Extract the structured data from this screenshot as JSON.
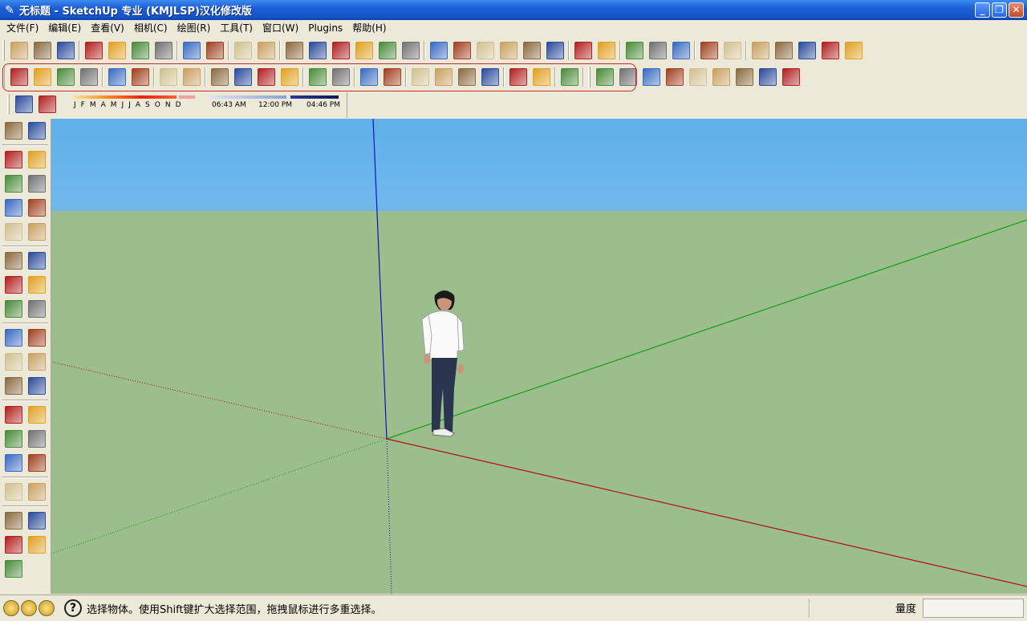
{
  "window": {
    "title": "无标题 - SketchUp 专业 (KMJLSP)汉化修改版",
    "minimize": "_",
    "maximize": "❐",
    "close": "✕"
  },
  "menu": [
    "文件(F)",
    "编辑(E)",
    "查看(V)",
    "相机(C)",
    "绘图(R)",
    "工具(T)",
    "窗口(W)",
    "Plugins",
    "帮助(H)"
  ],
  "shadow": {
    "months": [
      "J",
      "F",
      "M",
      "A",
      "M",
      "J",
      "J",
      "A",
      "S",
      "O",
      "N",
      "D"
    ],
    "time_start": "06:43 AM",
    "time_mid": "12:00 PM",
    "time_end": "04:46 PM"
  },
  "status": {
    "message": "选择物体。使用Shift键扩大选择范围，拖拽鼠标进行多重选择。",
    "measure_label": "量度",
    "measure_value": ""
  },
  "colors": {
    "axis_red": "#b01010",
    "axis_green": "#10a010",
    "axis_blue": "#1010c0",
    "ground": "#9cbd8c",
    "sky_top": "#5fb0ea"
  },
  "icons": {
    "row1": [
      "new-file-icon",
      "open-file-icon",
      "save-icon",
      "cut-icon",
      "copy-icon",
      "paste-icon",
      "delete-icon",
      "undo-icon",
      "redo-icon",
      "print-icon",
      "model-info-icon",
      "iso-view-icon",
      "top-view-icon",
      "front-view-icon",
      "right-view-icon",
      "back-view-icon",
      "left-view-icon",
      "xray-icon",
      "wireframe-icon",
      "hidden-line-icon",
      "shaded-icon",
      "shaded-texture-icon",
      "monochrome-icon",
      "geo-location-icon",
      "terrain-icon",
      "photo-texture-icon",
      "get-models-icon",
      "share-model-icon",
      "section-plane-icon",
      "section-cut-icon",
      "smoove-icon",
      "stamp-icon",
      "drape-icon",
      "add-detail-icon",
      "flip-edge-icon"
    ],
    "row2": [
      "orbit-cube-icon",
      "pipe-icon",
      "bezier-icon",
      "polyline-icon",
      "pyramid-icon",
      "star-icon",
      "cone-icon",
      "mesh-cone-icon",
      "push-pull-icon",
      "extrude-icon",
      "fold-icon",
      "flag-icon",
      "rope-icon",
      "box-icon",
      "solid-box-icon",
      "red-box-icon",
      "grid-icon",
      "hash-grid-icon",
      "red-grid-icon",
      "green-grid-icon",
      "tree-icon",
      "plant-icon",
      "fence-icon"
    ],
    "row2b": [
      "tag-m-icon",
      "tag-o-icon",
      "tag-e-icon",
      "cube-blue-icon",
      "clock-icon",
      "cloud-icon",
      "tag-heart-icon",
      "circle-icon",
      "diamond-icon"
    ],
    "row3": [
      "component-info-icon",
      "black-cube-icon"
    ],
    "left": [
      "select-icon",
      "component-icon",
      "paint-bucket-icon",
      "eraser-icon",
      "rectangle-icon",
      "pencil-icon",
      "circle-icon",
      "arc-icon",
      "polygon-icon",
      "freehand-icon",
      "move-icon",
      "push-pull-icon",
      "rotate-icon",
      "follow-me-icon",
      "scale-icon",
      "offset-icon",
      "tape-measure-icon",
      "dimension-icon",
      "protractor-icon",
      "text-icon",
      "axes-icon",
      "3d-text-icon",
      "orbit-icon",
      "pan-icon",
      "zoom-icon",
      "zoom-window-icon",
      "zoom-extents-icon",
      "previous-view-icon",
      "position-camera-icon",
      "look-around-icon",
      "walk-icon",
      "section-plane-icon",
      "hand-icon",
      "sandbox-icon",
      "layers-icon"
    ]
  }
}
